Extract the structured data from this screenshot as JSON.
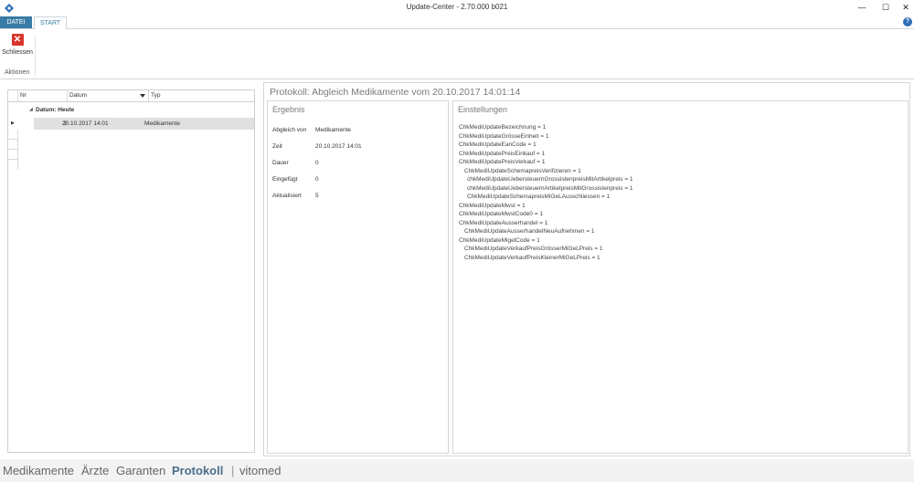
{
  "window": {
    "title": "Update-Center - 2.70.000 b021",
    "min_glyph": "—",
    "max_glyph": "☐",
    "close_glyph": "✕"
  },
  "ribbon": {
    "tabs": [
      {
        "label": "DATEI",
        "active": false
      },
      {
        "label": "START",
        "active": true
      }
    ],
    "actions": [
      {
        "label": "Schliessen",
        "icon": "close-x-icon"
      }
    ],
    "group_label": "Aktionen",
    "help_glyph": "?"
  },
  "grid": {
    "columns": [
      "Nr",
      "Datum",
      "Typ"
    ],
    "sorted_column": "Datum",
    "group": {
      "label": "Datum: Heute"
    },
    "rows": [
      {
        "nr": "3",
        "datum": "20.10.2017 14:01",
        "typ": "Medikamente"
      }
    ]
  },
  "protocol": {
    "title": "Protokoll: Abgleich Medikamente vom 20.10.2017 14:01:14",
    "ergebnis": {
      "title": "Ergebnis",
      "fields": [
        {
          "key": "Abgleich von",
          "value": "Medikamente"
        },
        {
          "key": "Zeit",
          "value": "20.10.2017 14:01"
        },
        {
          "key": "Dauer",
          "value": "0"
        },
        {
          "key": "Eingefügt",
          "value": "0"
        },
        {
          "key": "Aktualisiert",
          "value": "5"
        }
      ]
    },
    "einstellungen": {
      "title": "Einstellungen",
      "lines": [
        "ChkMediUpdateBezeichnung = 1",
        "ChkMediUpdateGrösseEinheit = 1",
        "ChkMediUpdateEanCode = 1",
        "ChkMediUpdatePreisEinkauf = 1",
        "ChkMediUpdatePreisVerkauf = 1",
        "  ChkMediUpdateSchemapreisVerifizieren = 1",
        "    chkMediUpdateUebersteuernGrossistenpreisMitArtikelpreis = 1",
        "    chkMediUpdateUebersteuernArtikelpreisMitGrossistenpreis = 1",
        "    ChkMediUpdateSchemapreisMiGeLAusschliessen = 1",
        "ChkMediUpdateMwst = 1",
        "ChkMediUpdateMwstCode0 = 1",
        "ChkMediUpdateAusserhandel = 1",
        "  ChkMediUpdateAusserhandelNeuAufnehmen = 1",
        "ChkMediUpdateMigelCode = 1",
        "  ChkMediUpdateVerkaufPreisGrösserMiGeLPreis = 1",
        "  ChkMediUpdateVerkaufPreisKleinerMiGeLPreis = 1"
      ]
    }
  },
  "bottom_nav": {
    "items": [
      "Medikamente",
      "Ärzte",
      "Garanten",
      "Protokoll",
      "vitomed"
    ],
    "active": "Protokoll",
    "separator": "|"
  },
  "colors": {
    "accent": "#3a7ca5",
    "close_red": "#d9342b",
    "help_blue": "#2e6fb5",
    "selected_row": "#e0e0e0",
    "active_nav": "#4a6f8a"
  }
}
